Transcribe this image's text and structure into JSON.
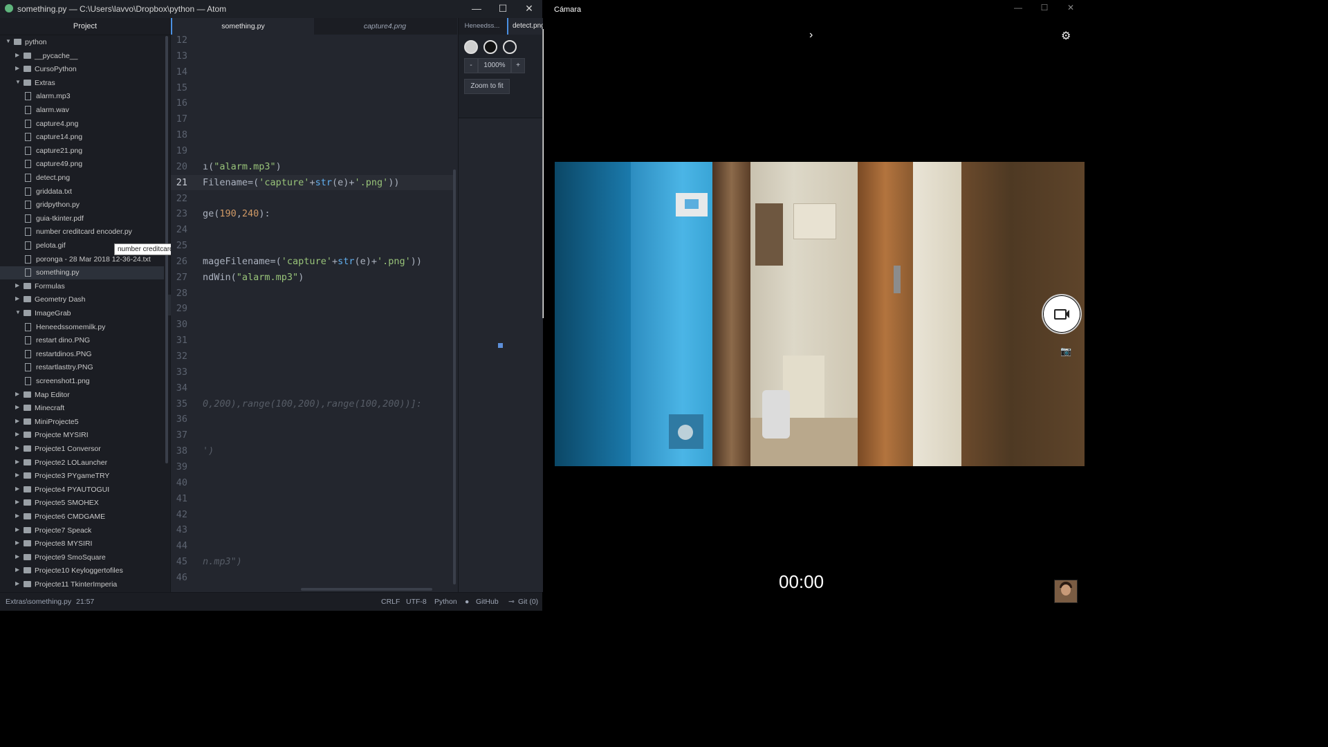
{
  "atom": {
    "title": "something.py — C:\\Users\\lavvo\\Dropbox\\python — Atom",
    "window_controls": {
      "minimize": "—",
      "maximize": "☐",
      "close": "✕"
    },
    "tree_view": {
      "header": "Project",
      "tooltip": "number creditcard encoder.py",
      "collapse_glyph": "‹",
      "items": [
        {
          "label": "python",
          "type": "folder",
          "expanded": true,
          "depth": 0
        },
        {
          "label": "__pycache__",
          "type": "folder",
          "expanded": false,
          "depth": 1
        },
        {
          "label": "CursoPython",
          "type": "folder",
          "expanded": false,
          "depth": 1
        },
        {
          "label": "Extras",
          "type": "folder",
          "expanded": true,
          "depth": 1
        },
        {
          "label": "alarm.mp3",
          "type": "file",
          "depth": 2
        },
        {
          "label": "alarm.wav",
          "type": "file",
          "depth": 2
        },
        {
          "label": "capture4.png",
          "type": "file",
          "depth": 2
        },
        {
          "label": "capture14.png",
          "type": "file",
          "depth": 2
        },
        {
          "label": "capture21.png",
          "type": "file",
          "depth": 2
        },
        {
          "label": "capture49.png",
          "type": "file",
          "depth": 2
        },
        {
          "label": "detect.png",
          "type": "file",
          "depth": 2
        },
        {
          "label": "griddata.txt",
          "type": "file",
          "depth": 2
        },
        {
          "label": "gridpython.py",
          "type": "file",
          "depth": 2
        },
        {
          "label": "guia-tkinter.pdf",
          "type": "file",
          "depth": 2
        },
        {
          "label": "number creditcard encoder.py",
          "type": "file",
          "depth": 2
        },
        {
          "label": "pelota.gif",
          "type": "file",
          "depth": 2
        },
        {
          "label": "poronga - 28 Mar 2018 12-36-24.txt",
          "type": "file",
          "depth": 2
        },
        {
          "label": "something.py",
          "type": "file",
          "depth": 2,
          "selected": true
        },
        {
          "label": "Formulas",
          "type": "folder",
          "expanded": false,
          "depth": 1
        },
        {
          "label": "Geometry Dash",
          "type": "folder",
          "expanded": false,
          "depth": 1
        },
        {
          "label": "ImageGrab",
          "type": "folder",
          "expanded": true,
          "depth": 1
        },
        {
          "label": "Heneedssomemilk.py",
          "type": "file",
          "depth": 2
        },
        {
          "label": "restart dino.PNG",
          "type": "file",
          "depth": 2
        },
        {
          "label": "restartdinos.PNG",
          "type": "file",
          "depth": 2
        },
        {
          "label": "restartlasttry.PNG",
          "type": "file",
          "depth": 2
        },
        {
          "label": "screenshot1.png",
          "type": "file",
          "depth": 2
        },
        {
          "label": "Map Editor",
          "type": "folder",
          "expanded": false,
          "depth": 1
        },
        {
          "label": "Minecraft",
          "type": "folder",
          "expanded": false,
          "depth": 1
        },
        {
          "label": "MiniProjecte5",
          "type": "folder",
          "expanded": false,
          "depth": 1
        },
        {
          "label": "Projecte MYSIRI",
          "type": "folder",
          "expanded": false,
          "depth": 1
        },
        {
          "label": "Projecte1 Conversor",
          "type": "folder",
          "expanded": false,
          "depth": 1
        },
        {
          "label": "Projecte2 LOLauncher",
          "type": "folder",
          "expanded": false,
          "depth": 1
        },
        {
          "label": "Projecte3 PYgameTRY",
          "type": "folder",
          "expanded": false,
          "depth": 1
        },
        {
          "label": "Projecte4 PYAUTOGUI",
          "type": "folder",
          "expanded": false,
          "depth": 1
        },
        {
          "label": "Projecte5 SMOHEX",
          "type": "folder",
          "expanded": false,
          "depth": 1
        },
        {
          "label": "Projecte6 CMDGAME",
          "type": "folder",
          "expanded": false,
          "depth": 1
        },
        {
          "label": "Projecte7 Speack",
          "type": "folder",
          "expanded": false,
          "depth": 1
        },
        {
          "label": "Projecte8 MYSIRI",
          "type": "folder",
          "expanded": false,
          "depth": 1
        },
        {
          "label": "Projecte9 SmoSquare",
          "type": "folder",
          "expanded": false,
          "depth": 1
        },
        {
          "label": "Projecte10 Keyloggertofiles",
          "type": "folder",
          "expanded": false,
          "depth": 1
        },
        {
          "label": "Projecte11 TkinterImperia",
          "type": "folder",
          "expanded": false,
          "depth": 1
        }
      ]
    },
    "editor_tabs": [
      {
        "label": "something.py",
        "active": true
      },
      {
        "label": "capture4.png",
        "active": false
      }
    ],
    "editor": {
      "current_line": 21,
      "line_numbers": [
        12,
        13,
        14,
        15,
        16,
        17,
        18,
        19,
        20,
        21,
        22,
        23,
        24,
        25,
        26,
        27,
        28,
        29,
        30,
        31,
        32,
        33,
        34,
        35,
        36,
        37,
        38,
        39,
        40,
        41,
        42,
        43,
        44,
        45,
        46
      ],
      "code_lines": [
        {
          "line": 20,
          "text": "ı(\"alarm.mp3\")"
        },
        {
          "line": 21,
          "text": "Filename=('capture'+str(e)+'.png'))"
        },
        {
          "line": 23,
          "text": "ge(190,240):"
        },
        {
          "line": 26,
          "text": "mageFilename=('capture'+str(e)+'.png'))"
        },
        {
          "line": 27,
          "text": "ndWin(\"alarm.mp3\")"
        },
        {
          "line": 35,
          "text": "0,200),range(100,200),range(100,200))]:",
          "faded": true
        },
        {
          "line": 38,
          "text": "')",
          "faded": true
        },
        {
          "line": 45,
          "text": "n.mp3\")",
          "faded": true
        }
      ]
    },
    "image_pane": {
      "tabs": [
        {
          "label": "Heneedss...",
          "active": false
        },
        {
          "label": "detect.png",
          "active": true
        }
      ],
      "zoom_minus": "-",
      "zoom_level": "1000%",
      "zoom_plus": "+",
      "zoom_to_fit": "Zoom to fit"
    },
    "status_bar": {
      "path": "Extras\\something.py",
      "cursor": "21:57",
      "line_ending": "CRLF",
      "encoding": "UTF-8",
      "grammar": "Python",
      "github": "GitHub",
      "git": "Git (0)"
    }
  },
  "camera": {
    "title": "Cámara",
    "window_controls": {
      "minimize": "—",
      "maximize": "☐",
      "close": "✕"
    },
    "arrow": "›",
    "settings_icon": "⚙",
    "timer": "00:00"
  },
  "colors": {
    "atom_bg": "#23262e",
    "tree_bg": "#1b1d23",
    "string": "#98c379",
    "function": "#61afef",
    "number": "#d19a66",
    "accent": "#4a90e2"
  }
}
